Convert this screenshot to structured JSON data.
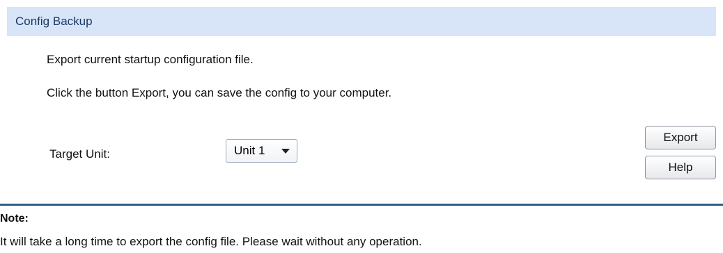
{
  "section": {
    "title": "Config Backup"
  },
  "description": {
    "line1": "Export current startup configuration file.",
    "line2": "Click the button Export, you can save the config to your computer."
  },
  "form": {
    "target_unit_label": "Target Unit:",
    "target_unit_value": "Unit 1",
    "target_unit_icon": "chevron-down-icon"
  },
  "buttons": {
    "export_label": "Export",
    "help_label": "Help"
  },
  "note": {
    "title": "Note:",
    "text": "It will take a long time to export the config file. Please wait without any operation."
  },
  "colors": {
    "header_bg": "#d8e4f7",
    "divider": "#2f5d86"
  }
}
